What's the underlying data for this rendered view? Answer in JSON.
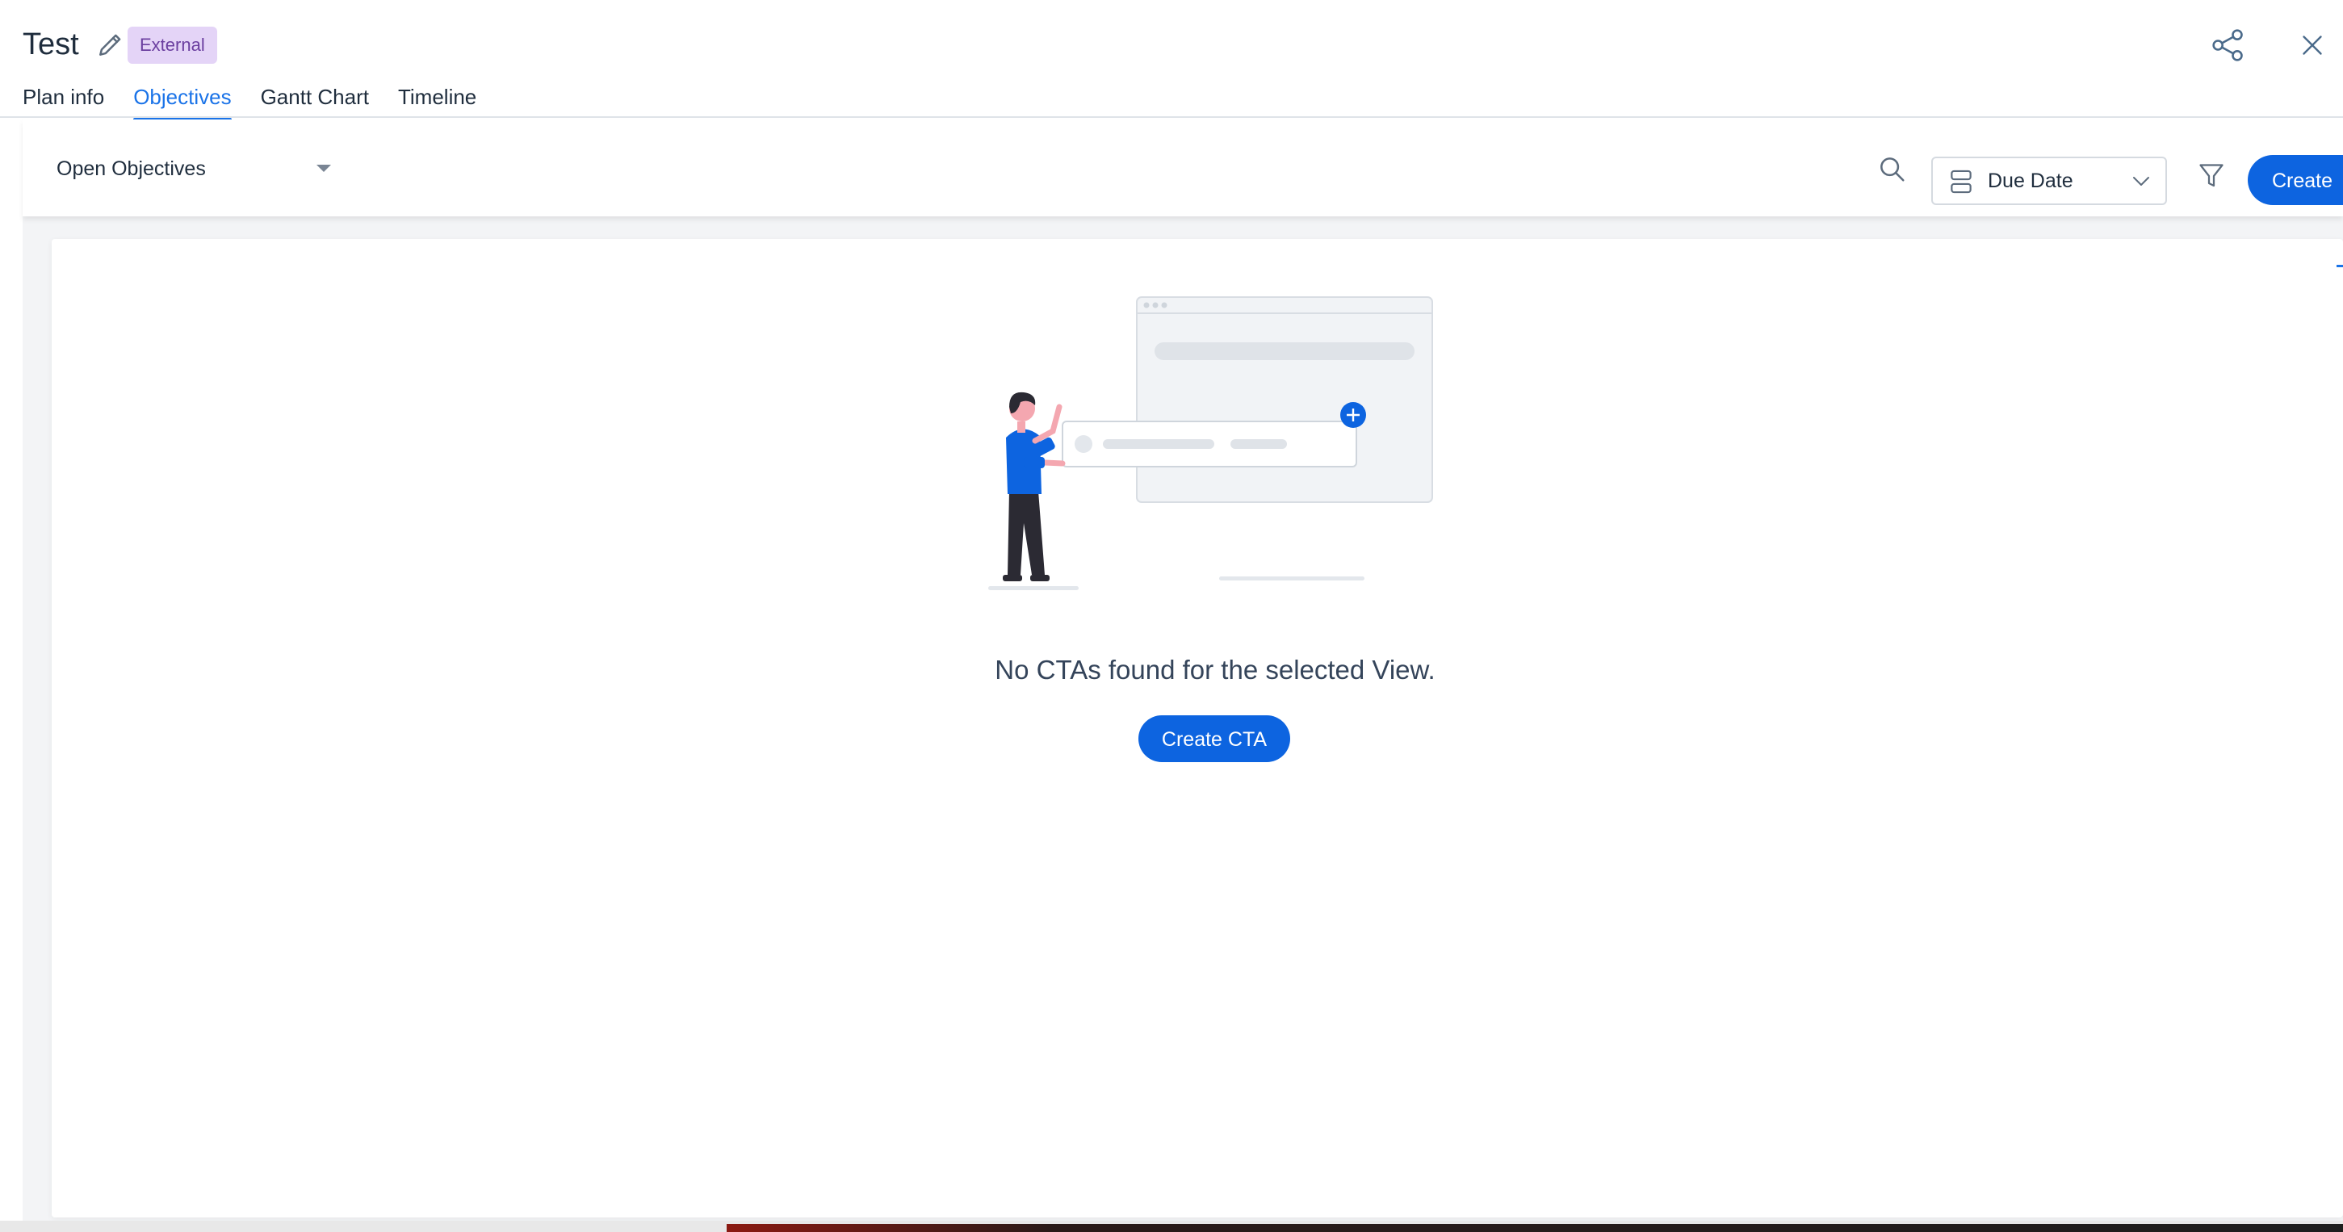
{
  "header": {
    "title": "Test",
    "badge": "External",
    "tabs": [
      {
        "label": "Plan info",
        "active": false
      },
      {
        "label": "Objectives",
        "active": true
      },
      {
        "label": "Gantt Chart",
        "active": false
      },
      {
        "label": "Timeline",
        "active": false
      }
    ]
  },
  "toolbar": {
    "view_select": "Open Objectives",
    "sort_select": "Due Date",
    "create_label": "Create"
  },
  "empty_state": {
    "message": "No CTAs found for the selected View.",
    "cta_label": "Create CTA"
  },
  "icons": {
    "edit": "pencil-icon",
    "share": "share-icon",
    "close": "close-icon",
    "search": "search-icon",
    "sort": "group-icon",
    "filter": "filter-icon"
  },
  "colors": {
    "accent": "#1a73e8",
    "button": "#0d64e0",
    "badge_bg": "#e4d4f7",
    "badge_text": "#6b3fa0"
  }
}
